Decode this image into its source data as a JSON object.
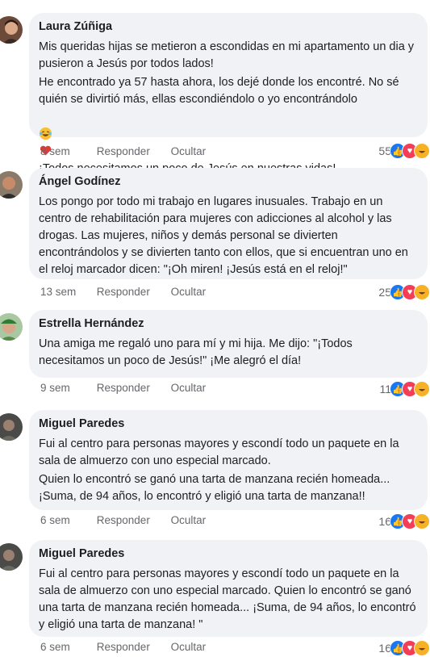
{
  "comments": [
    {
      "author": "Laura Zúñiga",
      "paragraphs": [
        "Mis queridas hijas se metieron a escondidas en mi apartamento un dia y pusieron a Jesús por todos lados!",
        "He encontrado ya 57 hasta ahora, los dejé donde los encontré. No sé quién se divirtió más, ellas escondiéndolo o yo encontrándolo",
        "¡Todos necesitamos un poco de Jesús en nuestras vidas!"
      ],
      "time": "8 sem",
      "reply": "Responder",
      "hide": "Ocultar",
      "reaction_count": "55"
    },
    {
      "author": "Ángel Godínez",
      "paragraphs": [
        "Los pongo por todo mi trabajo en lugares inusuales. Trabajo en un centro de rehabilitación para mujeres con adicciones al alcohol y las drogas. Las mujeres, niños y demás personal se divierten encontrándolos y se divierten tanto con ellos, que si encuentran uno en el reloj marcador dicen: \"¡Oh miren! ¡Jesús está en el reloj!\""
      ],
      "time": "13 sem",
      "reply": "Responder",
      "hide": "Ocultar",
      "reaction_count": "25"
    },
    {
      "author": "Estrella Hernández",
      "paragraphs": [
        "Una amiga me regaló uno para mí y mi hija. Me dijo: \"¡Todos necesitamos un poco de Jesús!\" ¡Me alegró el día!"
      ],
      "time": "9 sem",
      "reply": "Responder",
      "hide": "Ocultar",
      "reaction_count": "11"
    },
    {
      "author": "Miguel Paredes",
      "paragraphs": [
        "Fui al centro para personas mayores y escondí todo un paquete en la sala de almuerzo con uno especial marcado.",
        "Quien lo encontró se ganó una tarta de manzana recién homeada... ¡Suma, de 94 años, lo encontró y eligió una tarta de manzana!!"
      ],
      "time": "6 sem",
      "reply": "Responder",
      "hide": "Ocultar",
      "reaction_count": "16"
    },
    {
      "author": "Miguel Paredes",
      "paragraphs": [
        "Fui al centro para personas mayores y escondí todo un paquete en la sala de almuerzo con uno especial marcado. Quien lo encontró se ganó una tarta de manzana recién homeada... ¡Suma, de 94 años, lo encontró y eligió una tarta de manzana! \""
      ],
      "time": "6 sem",
      "reply": "Responder",
      "hide": "Ocultar",
      "reaction_count": "16"
    }
  ],
  "colors": {
    "bubble": "#f0f2f5",
    "meta_text": "#65676b",
    "like": "#1877f2",
    "love": "#f33e58",
    "haha": "#f7b125"
  },
  "icons": [
    "like-icon",
    "love-icon",
    "haha-icon",
    "laughing-tears-emoji",
    "red-heart-emoji"
  ]
}
